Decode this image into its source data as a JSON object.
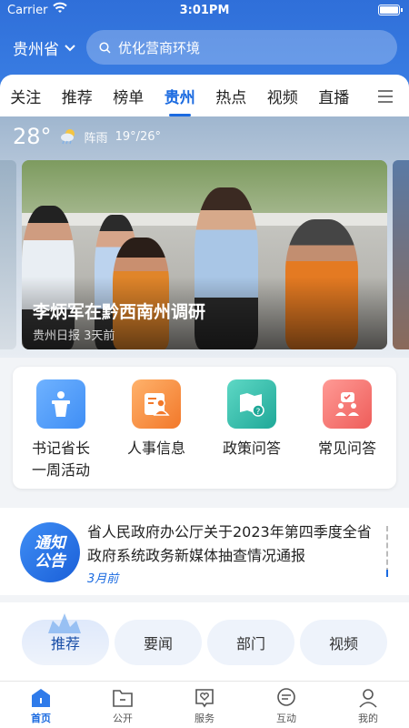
{
  "status_bar": {
    "carrier": "Carrier",
    "time": "3:01PM"
  },
  "header": {
    "region": "贵州省",
    "search_placeholder": "优化营商环境"
  },
  "tabs": [
    {
      "label": "关注"
    },
    {
      "label": "推荐"
    },
    {
      "label": "榜单"
    },
    {
      "label": "贵州",
      "active": true
    },
    {
      "label": "热点"
    },
    {
      "label": "视频"
    },
    {
      "label": "直播"
    }
  ],
  "weather": {
    "temperature": "28°",
    "condition": "阵雨",
    "range": "19°/26°",
    "icon": "rain-cloud-icon"
  },
  "banner": {
    "title": "李炳军在黔西南州调研",
    "source": "贵州日报",
    "time_ago": "3天前"
  },
  "services": [
    {
      "label_line1": "书记省长",
      "label_line2": "一周活动",
      "icon": "podium-icon",
      "color": "#3f8ef5"
    },
    {
      "label_line1": "人事信息",
      "label_line2": "",
      "icon": "person-card-icon",
      "color": "#f28a3a"
    },
    {
      "label_line1": "政策问答",
      "label_line2": "",
      "icon": "map-question-icon",
      "color": "#22b7a6"
    },
    {
      "label_line1": "常见问答",
      "label_line2": "",
      "icon": "people-chat-icon",
      "color": "#f0605e"
    }
  ],
  "notice": {
    "badge_line1": "通知",
    "badge_line2": "公告",
    "title": "省人民政府办公厅关于2023年第四季度全省政府系统政务新媒体抽查情况通报",
    "time": "3月前"
  },
  "filters": [
    {
      "label": "推荐",
      "active": true
    },
    {
      "label": "要闻"
    },
    {
      "label": "部门"
    },
    {
      "label": "视频"
    }
  ],
  "bottom_nav": [
    {
      "label": "首页",
      "icon": "home-icon",
      "active": true
    },
    {
      "label": "公开",
      "icon": "folder-icon"
    },
    {
      "label": "服务",
      "icon": "heart-chat-icon"
    },
    {
      "label": "互动",
      "icon": "chat-bubble-icon"
    },
    {
      "label": "我的",
      "icon": "user-icon"
    }
  ],
  "colors": {
    "brand": "#2f6fd9",
    "active_tab": "#1a6ae0"
  }
}
